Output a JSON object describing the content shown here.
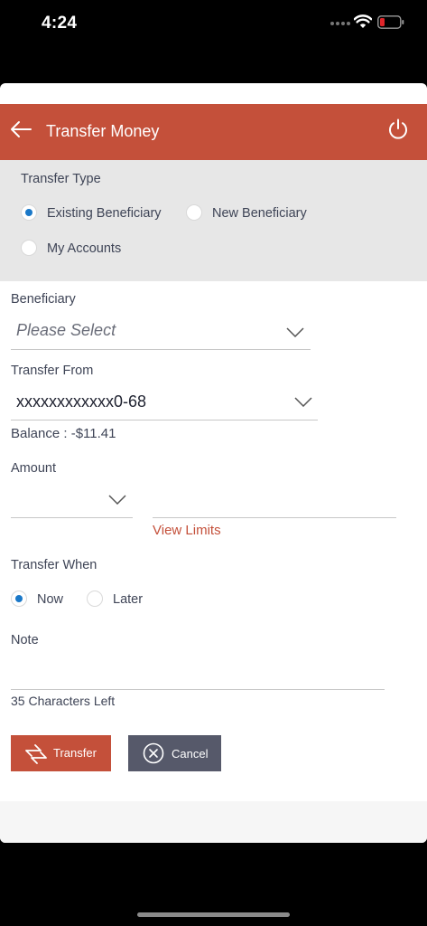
{
  "status": {
    "time": "4:24"
  },
  "header": {
    "title": "Transfer Money"
  },
  "transfer_type": {
    "label": "Transfer Type",
    "options": [
      {
        "label": "Existing Beneficiary",
        "selected": true
      },
      {
        "label": "New Beneficiary",
        "selected": false
      },
      {
        "label": "My Accounts",
        "selected": false
      }
    ]
  },
  "beneficiary": {
    "label": "Beneficiary",
    "value": "Please Select"
  },
  "transfer_from": {
    "label": "Transfer From",
    "value": "xxxxxxxxxxxx0-68",
    "balance": "Balance : -$11.41"
  },
  "amount": {
    "label": "Amount",
    "currency": "",
    "value": "",
    "view_limits": "View Limits"
  },
  "transfer_when": {
    "label": "Transfer When",
    "options": [
      {
        "label": "Now",
        "selected": true
      },
      {
        "label": "Later",
        "selected": false
      }
    ]
  },
  "note": {
    "label": "Note",
    "value": "",
    "chars_left": "35 Characters Left"
  },
  "buttons": {
    "transfer": "Transfer",
    "cancel": "Cancel"
  },
  "colors": {
    "brand": "#c4503a",
    "radio_selected": "#1a78c8",
    "cancel_button": "#56596a",
    "section_bg": "#e7e7e7"
  }
}
